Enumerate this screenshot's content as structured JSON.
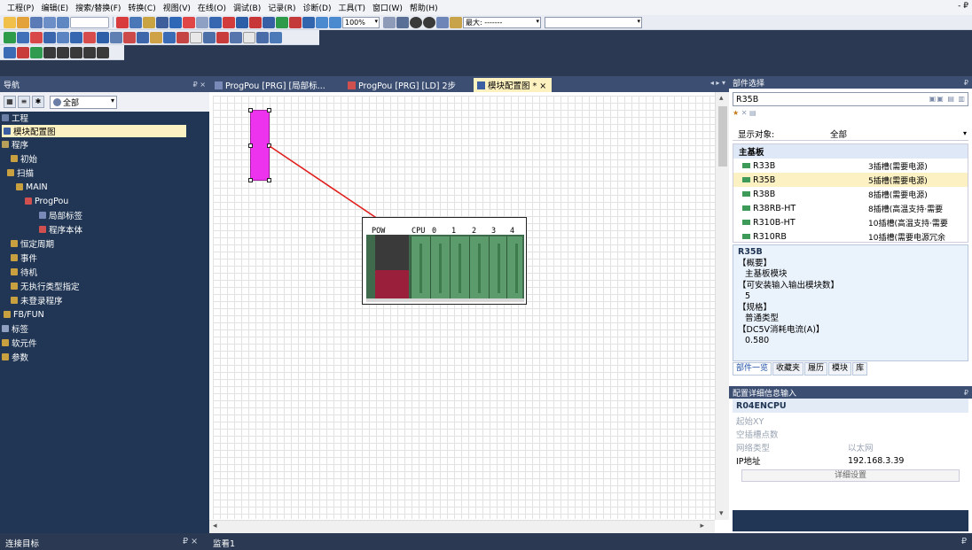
{
  "menu": {
    "items": [
      "工程(P)",
      "编辑(E)",
      "搜索/替换(F)",
      "转换(C)",
      "视图(V)",
      "在线(O)",
      "调试(B)",
      "记录(R)",
      "诊断(D)",
      "工具(T)",
      "窗口(W)",
      "帮助(H)"
    ],
    "window_controls": "- ₽"
  },
  "toolbar": {
    "zoom": "100%",
    "search_value": "最大: -------"
  },
  "navigation": {
    "title": "导航",
    "pin": "₽ ×",
    "filter_value": "全部",
    "tree": [
      {
        "label": "工程",
        "icon_color": "#6b7fa6"
      },
      {
        "label": "模块配置图",
        "icon_color": "#3c5ea3",
        "selected": true
      },
      {
        "label": "程序",
        "icon_color": "#b8a05a"
      },
      {
        "label": "初始",
        "icon_color": "#c8a040"
      },
      {
        "label": "扫描",
        "icon_color": "#c8a040"
      },
      {
        "label": "MAIN",
        "icon_color": "#c8a040"
      },
      {
        "label": "ProgPou",
        "icon_color": "#d05050"
      },
      {
        "label": "局部标签",
        "icon_color": "#7a8ab8"
      },
      {
        "label": "程序本体",
        "icon_color": "#d05050"
      },
      {
        "label": "恒定周期",
        "icon_color": "#c8a040"
      },
      {
        "label": "事件",
        "icon_color": "#c8a040"
      },
      {
        "label": "待机",
        "icon_color": "#c8a040"
      },
      {
        "label": "无执行类型指定",
        "icon_color": "#c8a040"
      },
      {
        "label": "未登录程序",
        "icon_color": "#c8a040"
      },
      {
        "label": "FB/FUN",
        "icon_color": "#c8a040"
      },
      {
        "label": "标签",
        "icon_color": "#8fa0c0"
      },
      {
        "label": "软元件",
        "icon_color": "#c8a040"
      },
      {
        "label": "参数",
        "icon_color": "#c8a040"
      }
    ]
  },
  "tabs": [
    {
      "label": "ProgPou [PRG] [局部标...",
      "icon_color": "#7a8ab8"
    },
    {
      "label": "ProgPou [PRG] [LD] 2步",
      "icon_color": "#d05050"
    },
    {
      "label": "模块配置图 * ×",
      "icon_color": "#3c5ea3",
      "active": true
    }
  ],
  "tab_nav": "◂ ▸ ▾",
  "rack": {
    "labels": [
      "POW",
      "CPU",
      "0",
      "1",
      "2",
      "3",
      "4"
    ]
  },
  "parts": {
    "title": "部件选择",
    "pin": "₽",
    "search_value": "R35B",
    "filter_label": "显示对象:",
    "filter_value": "全部",
    "group": "主基板",
    "rows": [
      {
        "name": "R33B",
        "desc": "3插槽(需要电源)"
      },
      {
        "name": "R35B",
        "desc": "5插槽(需要电源)",
        "selected": true
      },
      {
        "name": "R38B",
        "desc": "8插槽(需要电源)"
      },
      {
        "name": "R38RB-HT",
        "desc": "8插槽(高温支持·需要"
      },
      {
        "name": "R310B-HT",
        "desc": "10插槽(高温支持·需要"
      },
      {
        "name": "R310RB",
        "desc": "10插槽(需要电源冗余"
      }
    ],
    "detail": {
      "title": "R35B",
      "lines": [
        "【概要】",
        "  主基板模块",
        "【可安装输入输出模块数】",
        "  5",
        "【规格】",
        "  普通类型",
        "【DC5V消耗电流(A)】",
        "  0.580"
      ]
    },
    "bottom_tabs": [
      "部件一览",
      "收藏夹",
      "履历",
      "模块",
      "库"
    ]
  },
  "config": {
    "title": "配置详细信息输入",
    "pin": "₽",
    "module": "R04ENCPU",
    "rows": [
      {
        "key": "起始XY",
        "value": ""
      },
      {
        "key": "空插槽点数",
        "value": ""
      },
      {
        "key": "网络类型",
        "value": "以太网"
      },
      {
        "key": "IP地址",
        "value": "192.168.3.39"
      }
    ],
    "button": "详细设置"
  },
  "statusbar": {
    "left_title": "连接目标",
    "left_pin": "₽ ×",
    "right_title": "监看1",
    "right_pin": "₽"
  },
  "colors": {
    "nav_bg": "#203654",
    "pane_title": "#3c4f73",
    "selection": "#fcf1c3",
    "arrow": "#e0201e",
    "module_magenta": "#ee33ee"
  }
}
